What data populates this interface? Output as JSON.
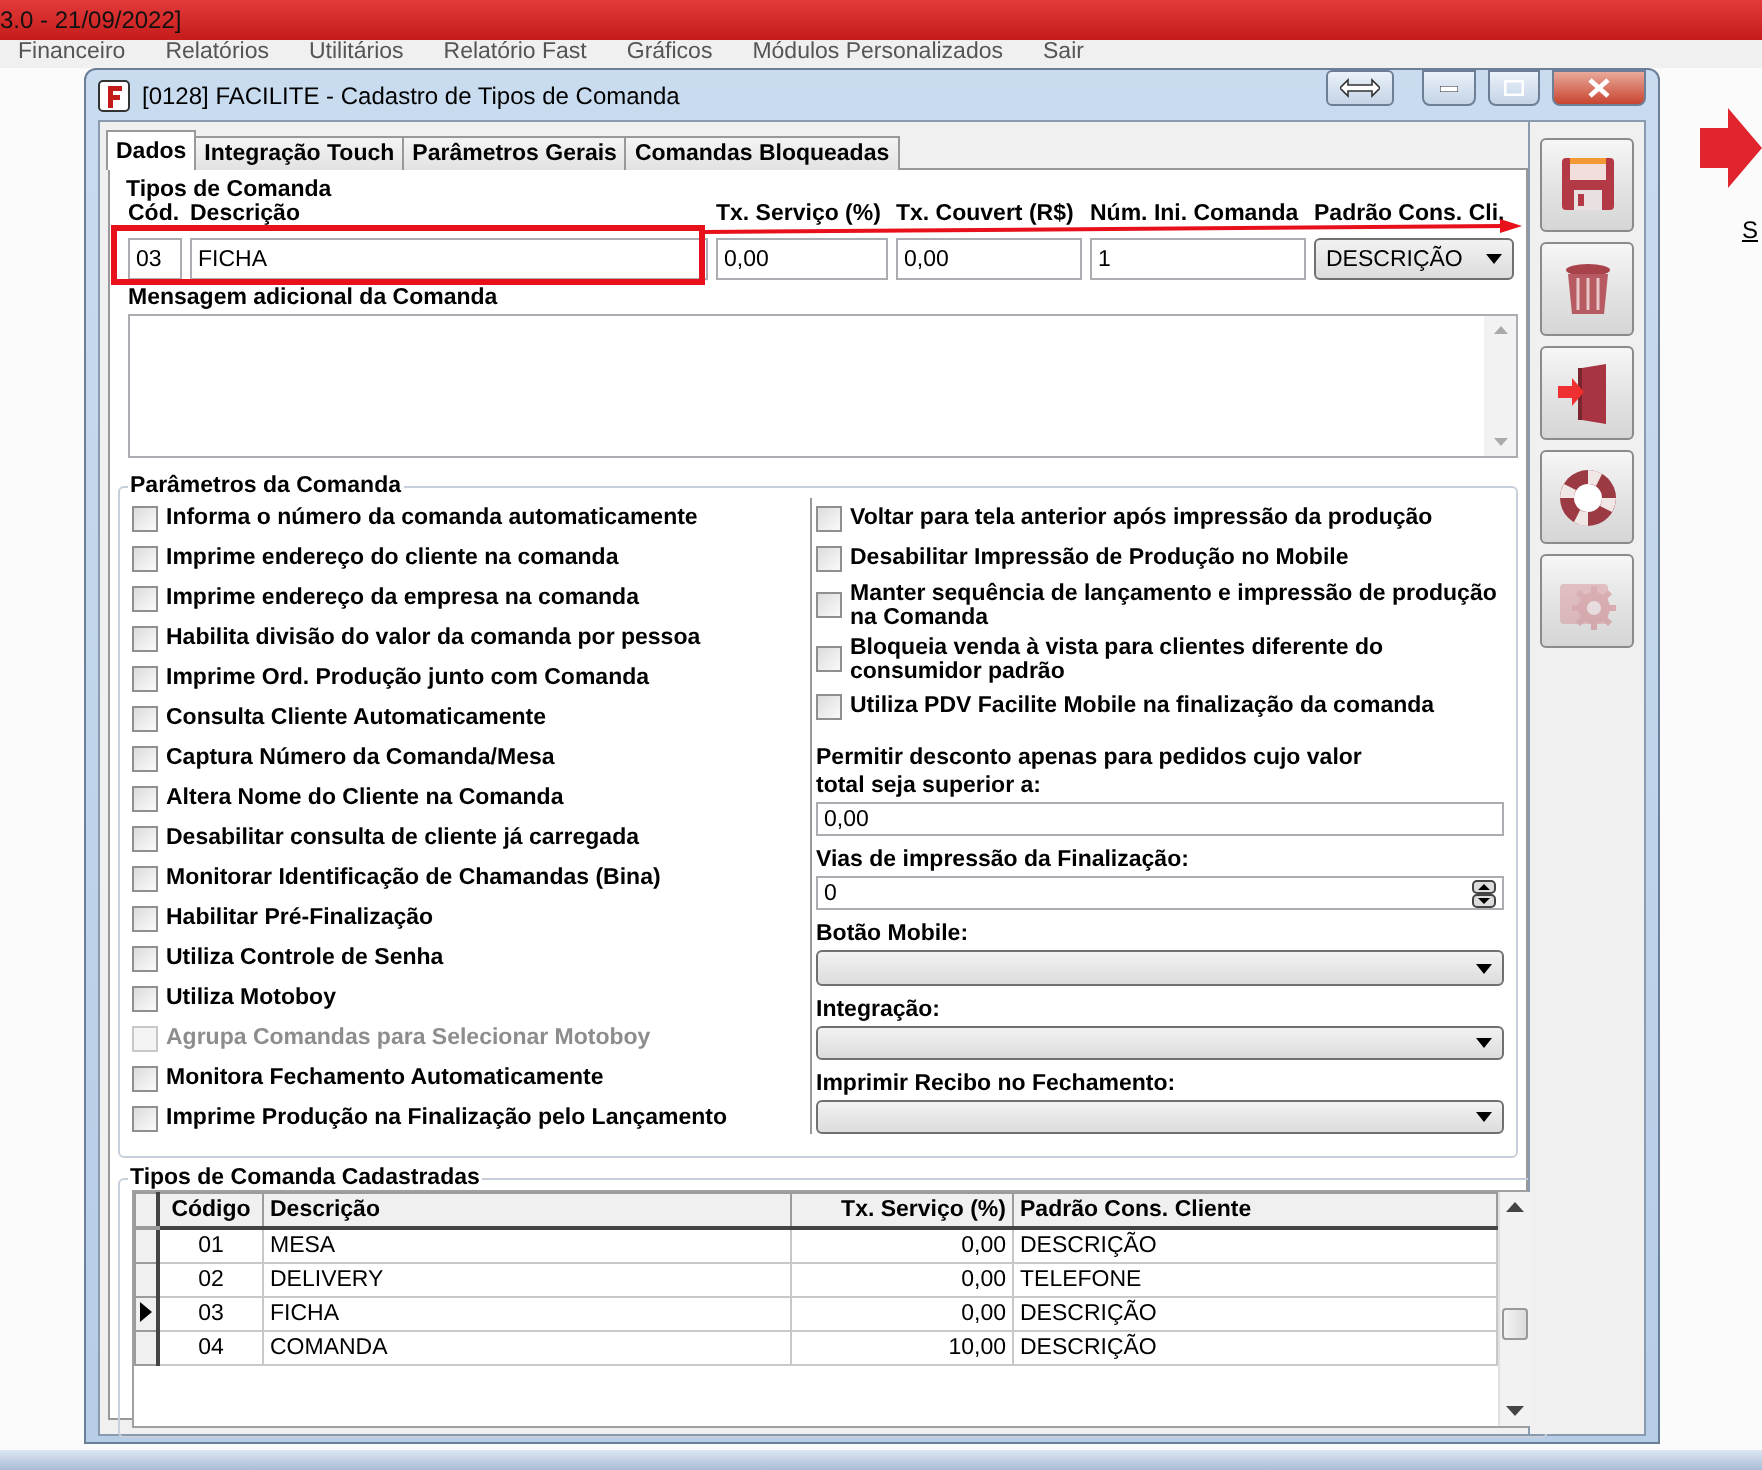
{
  "app": {
    "title": "3.0 - 21/09/2022]",
    "menu": [
      "Financeiro",
      "Relatórios",
      "Utilitários",
      "Relatório Fast",
      "Gráficos",
      "Módulos Personalizados",
      "Sair"
    ],
    "side_label": "S"
  },
  "window": {
    "title": "[0128] FACILITE - Cadastro de Tipos de Comanda"
  },
  "tabs": [
    {
      "label": "Dados",
      "selected": true
    },
    {
      "label": "Integração Touch",
      "selected": false
    },
    {
      "label": "Parâmetros Gerais",
      "selected": false
    },
    {
      "label": "Comandas Bloqueadas",
      "selected": false
    }
  ],
  "tipos": {
    "legend": "Tipos de Comanda",
    "fields": [
      {
        "kind": "text",
        "label": "Cód.",
        "value": "03"
      },
      {
        "kind": "text",
        "label": "Descrição",
        "value": "FICHA"
      },
      {
        "kind": "text",
        "label": "Tx. Serviço (%)",
        "value": "0,00"
      },
      {
        "kind": "text",
        "label": "Tx. Couvert (R$)",
        "value": "0,00"
      },
      {
        "kind": "text",
        "label": "Núm. Ini. Comanda",
        "value": "1"
      },
      {
        "kind": "select",
        "label": "Padrão Cons. Cli.",
        "value": "DESCRIÇÃO"
      }
    ]
  },
  "mensagem": {
    "label": "Mensagem adicional da Comanda"
  },
  "parametros": {
    "legend": "Parâmetros da Comanda",
    "left": [
      {
        "label": "Informa o número da comanda automaticamente",
        "checked": false,
        "disabled": false
      },
      {
        "label": "Imprime endereço do cliente na comanda",
        "checked": false,
        "disabled": false
      },
      {
        "label": "Imprime endereço da empresa na comanda",
        "checked": false,
        "disabled": false
      },
      {
        "label": "Habilita divisão do valor da comanda por pessoa",
        "checked": false,
        "disabled": false
      },
      {
        "label": "Imprime Ord. Produção junto com Comanda",
        "checked": false,
        "disabled": false
      },
      {
        "label": "Consulta Cliente Automaticamente",
        "checked": false,
        "disabled": false
      },
      {
        "label": "Captura Número da Comanda/Mesa",
        "checked": false,
        "disabled": false
      },
      {
        "label": "Altera Nome do Cliente na Comanda",
        "checked": false,
        "disabled": false
      },
      {
        "label": "Desabilitar consulta de cliente já carregada",
        "checked": false,
        "disabled": false
      },
      {
        "label": "Monitorar Identificação de Chamandas (Bina)",
        "checked": false,
        "disabled": false
      },
      {
        "label": "Habilitar Pré-Finalização",
        "checked": false,
        "disabled": false
      },
      {
        "label": "Utiliza Controle de Senha",
        "checked": false,
        "disabled": false
      },
      {
        "label": "Utiliza Motoboy",
        "checked": false,
        "disabled": false
      },
      {
        "label": "Agrupa Comandas para Selecionar Motoboy",
        "checked": false,
        "disabled": true
      },
      {
        "label": "Monitora Fechamento Automaticamente",
        "checked": false,
        "disabled": false
      },
      {
        "label": "Imprime Produção na Finalização pelo Lançamento",
        "checked": false,
        "disabled": false
      }
    ],
    "right": [
      {
        "kind": "check",
        "label": "Voltar para tela anterior após impressão da produção",
        "checked": false
      },
      {
        "kind": "check",
        "label": "Desabilitar Impressão de Produção no Mobile",
        "checked": false
      },
      {
        "kind": "check",
        "label": "Manter sequência de lançamento e impressão de produção na Comanda",
        "checked": false
      },
      {
        "kind": "check",
        "label": "Bloqueia venda à vista para clientes diferente do consumidor padrão",
        "checked": false
      },
      {
        "kind": "check",
        "label": "Utiliza PDV Facilite Mobile na finalização da comanda",
        "checked": false
      },
      {
        "kind": "text",
        "label": "Permitir desconto apenas para pedidos cujo valor total seja superior a:",
        "value": "0,00"
      },
      {
        "kind": "spin",
        "label": "Vias de impressão da Finalização:",
        "value": "0"
      },
      {
        "kind": "select",
        "label": "Botão Mobile:"
      },
      {
        "kind": "select",
        "label": "Integração:"
      },
      {
        "kind": "select",
        "label": "Imprimir Recibo no Fechamento:"
      }
    ]
  },
  "grid": {
    "legend": "Tipos de Comanda Cadastradas",
    "columns": [
      "Código",
      "Descrição",
      "Tx. Serviço (%)",
      "Padrão Cons. Cliente"
    ],
    "rows": [
      {
        "cells": [
          "01",
          "MESA",
          "0,00",
          "DESCRIÇÃO"
        ],
        "selected": false
      },
      {
        "cells": [
          "02",
          "DELIVERY",
          "0,00",
          "TELEFONE"
        ],
        "selected": false
      },
      {
        "cells": [
          "03",
          "FICHA",
          "0,00",
          "DESCRIÇÃO"
        ],
        "selected": true
      },
      {
        "cells": [
          "04",
          "COMANDA",
          "10,00",
          "DESCRIÇÃO"
        ],
        "selected": false
      }
    ]
  },
  "toolbar": [
    {
      "kind": "save",
      "disabled": false
    },
    {
      "kind": "delete",
      "disabled": false
    },
    {
      "kind": "exit",
      "disabled": false
    },
    {
      "kind": "help",
      "disabled": false
    },
    {
      "kind": "settings",
      "disabled": true
    }
  ]
}
